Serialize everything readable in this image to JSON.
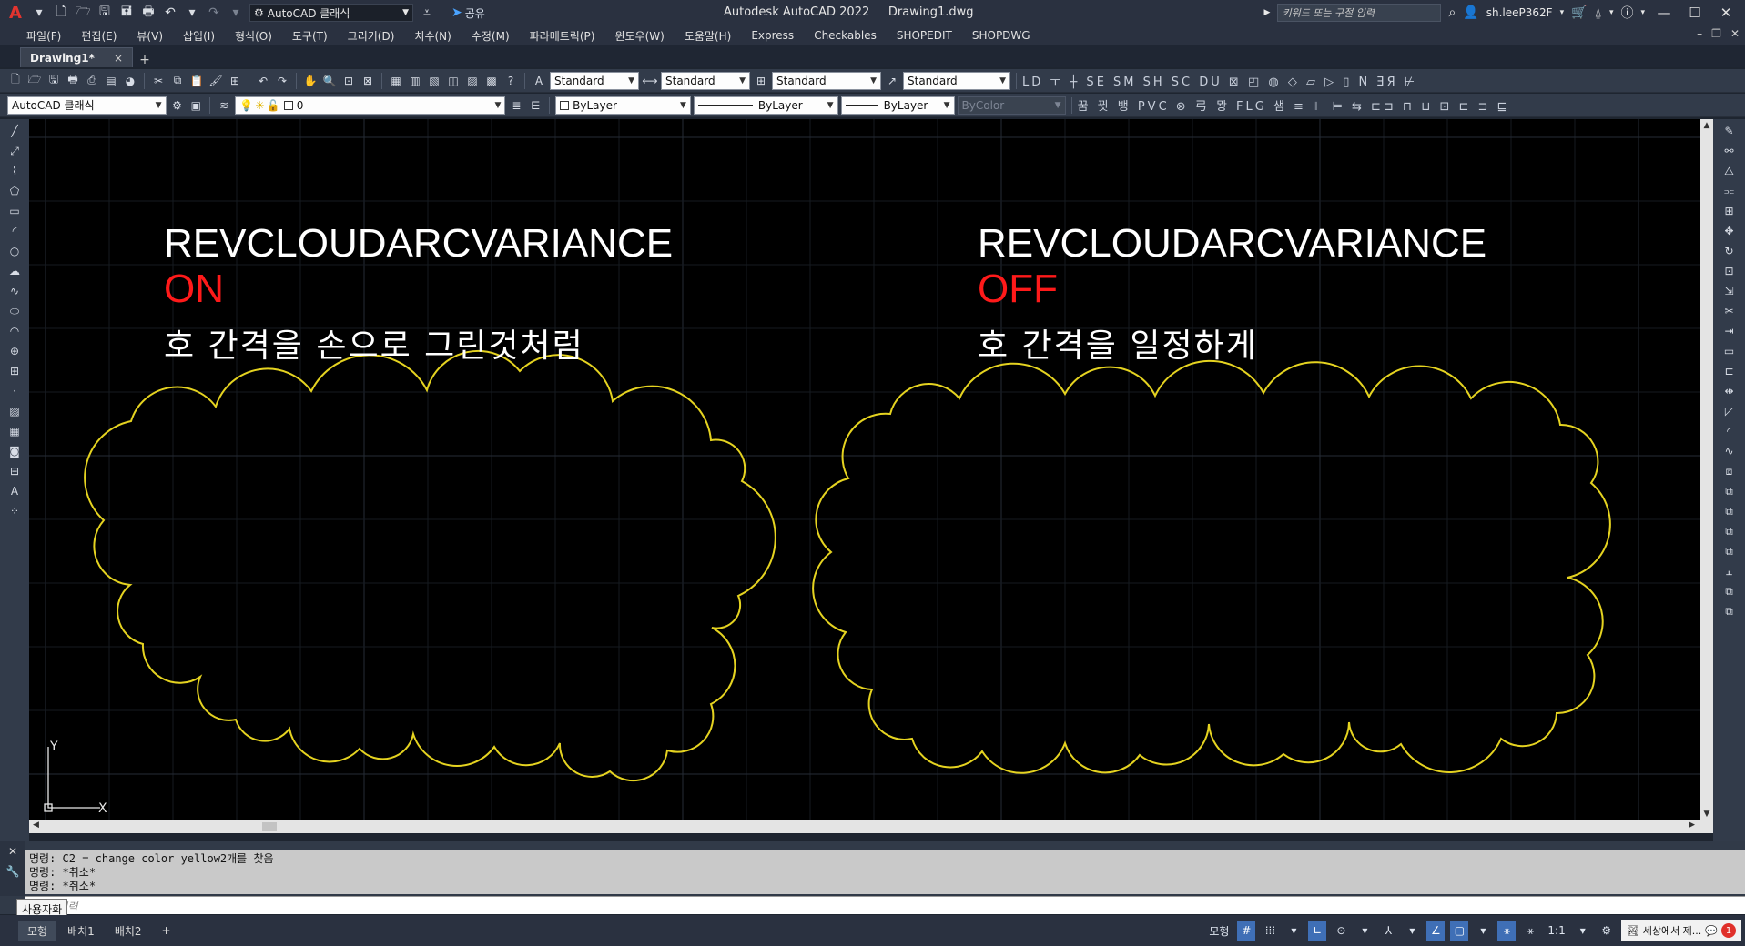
{
  "app": {
    "logo": "A",
    "title": "Autodesk AutoCAD 2022",
    "filename": "Drawing1.dwg",
    "workspace": "AutoCAD 클래식",
    "share_label": "공유",
    "search_placeholder": "키워드 또는 구절 입력",
    "user": "sh.leeP362F"
  },
  "menu": [
    "파일(F)",
    "편집(E)",
    "뷰(V)",
    "삽입(I)",
    "형식(O)",
    "도구(T)",
    "그리기(D)",
    "치수(N)",
    "수정(M)",
    "파라메트릭(P)",
    "윈도우(W)",
    "도움말(H)",
    "Express",
    "Checkables",
    "SHOPEDIT",
    "SHOPDWG"
  ],
  "tabs": {
    "doc": "Drawing1*",
    "close": "×",
    "add": "+"
  },
  "toolbar1": {
    "text_style": "Standard",
    "dim_style": "Standard",
    "table_style": "Standard",
    "mleader_style": "Standard",
    "cmd_glyphs": "LD ㅜ ┼ SE SM SH SC  DU ⊠ ◰ ◍ ◇ ▱ ▷ ▯ N ƎЯ ⊬"
  },
  "toolbar2": {
    "workspace": "AutoCAD 클래식",
    "layer": "0",
    "color": "ByLayer",
    "linetype": "ByLayer",
    "lineweight": "ByLayer",
    "plotstyle": "ByColor",
    "cmd_glyphs": "꿈 꿧 뱅 PVC ⊗ 弓 뫙 FLG 샘 ≡ ⊩ ⊨ ⇆ ⊏⊐ ⊓ ⊔ ⊡ ⊏ ⊐ ⊑"
  },
  "drawing": {
    "left": {
      "title": "REVCLOUDARCVARIANCE",
      "state": "ON",
      "desc": "호 간격을 손으로 그린것처럼"
    },
    "right": {
      "title": "REVCLOUDARCVARIANCE",
      "state": "OFF",
      "desc": "호 간격을 일정하게"
    },
    "cloud_color": "#e5d320",
    "on_color": "#ff1a1a",
    "ucs": {
      "x": "X",
      "y": "Y"
    }
  },
  "command": {
    "history": [
      "명령: C2  = change color yellow2개를 찾음",
      "명령: *취소*",
      "명령: *취소*"
    ],
    "placeholder": "명령 입력",
    "tooltip": "사용자화"
  },
  "layouts": [
    "모형",
    "배치1",
    "배치2"
  ],
  "status": {
    "model": "모형",
    "scale": "1:1",
    "notification": "세상에서 제...",
    "badge": "1"
  }
}
